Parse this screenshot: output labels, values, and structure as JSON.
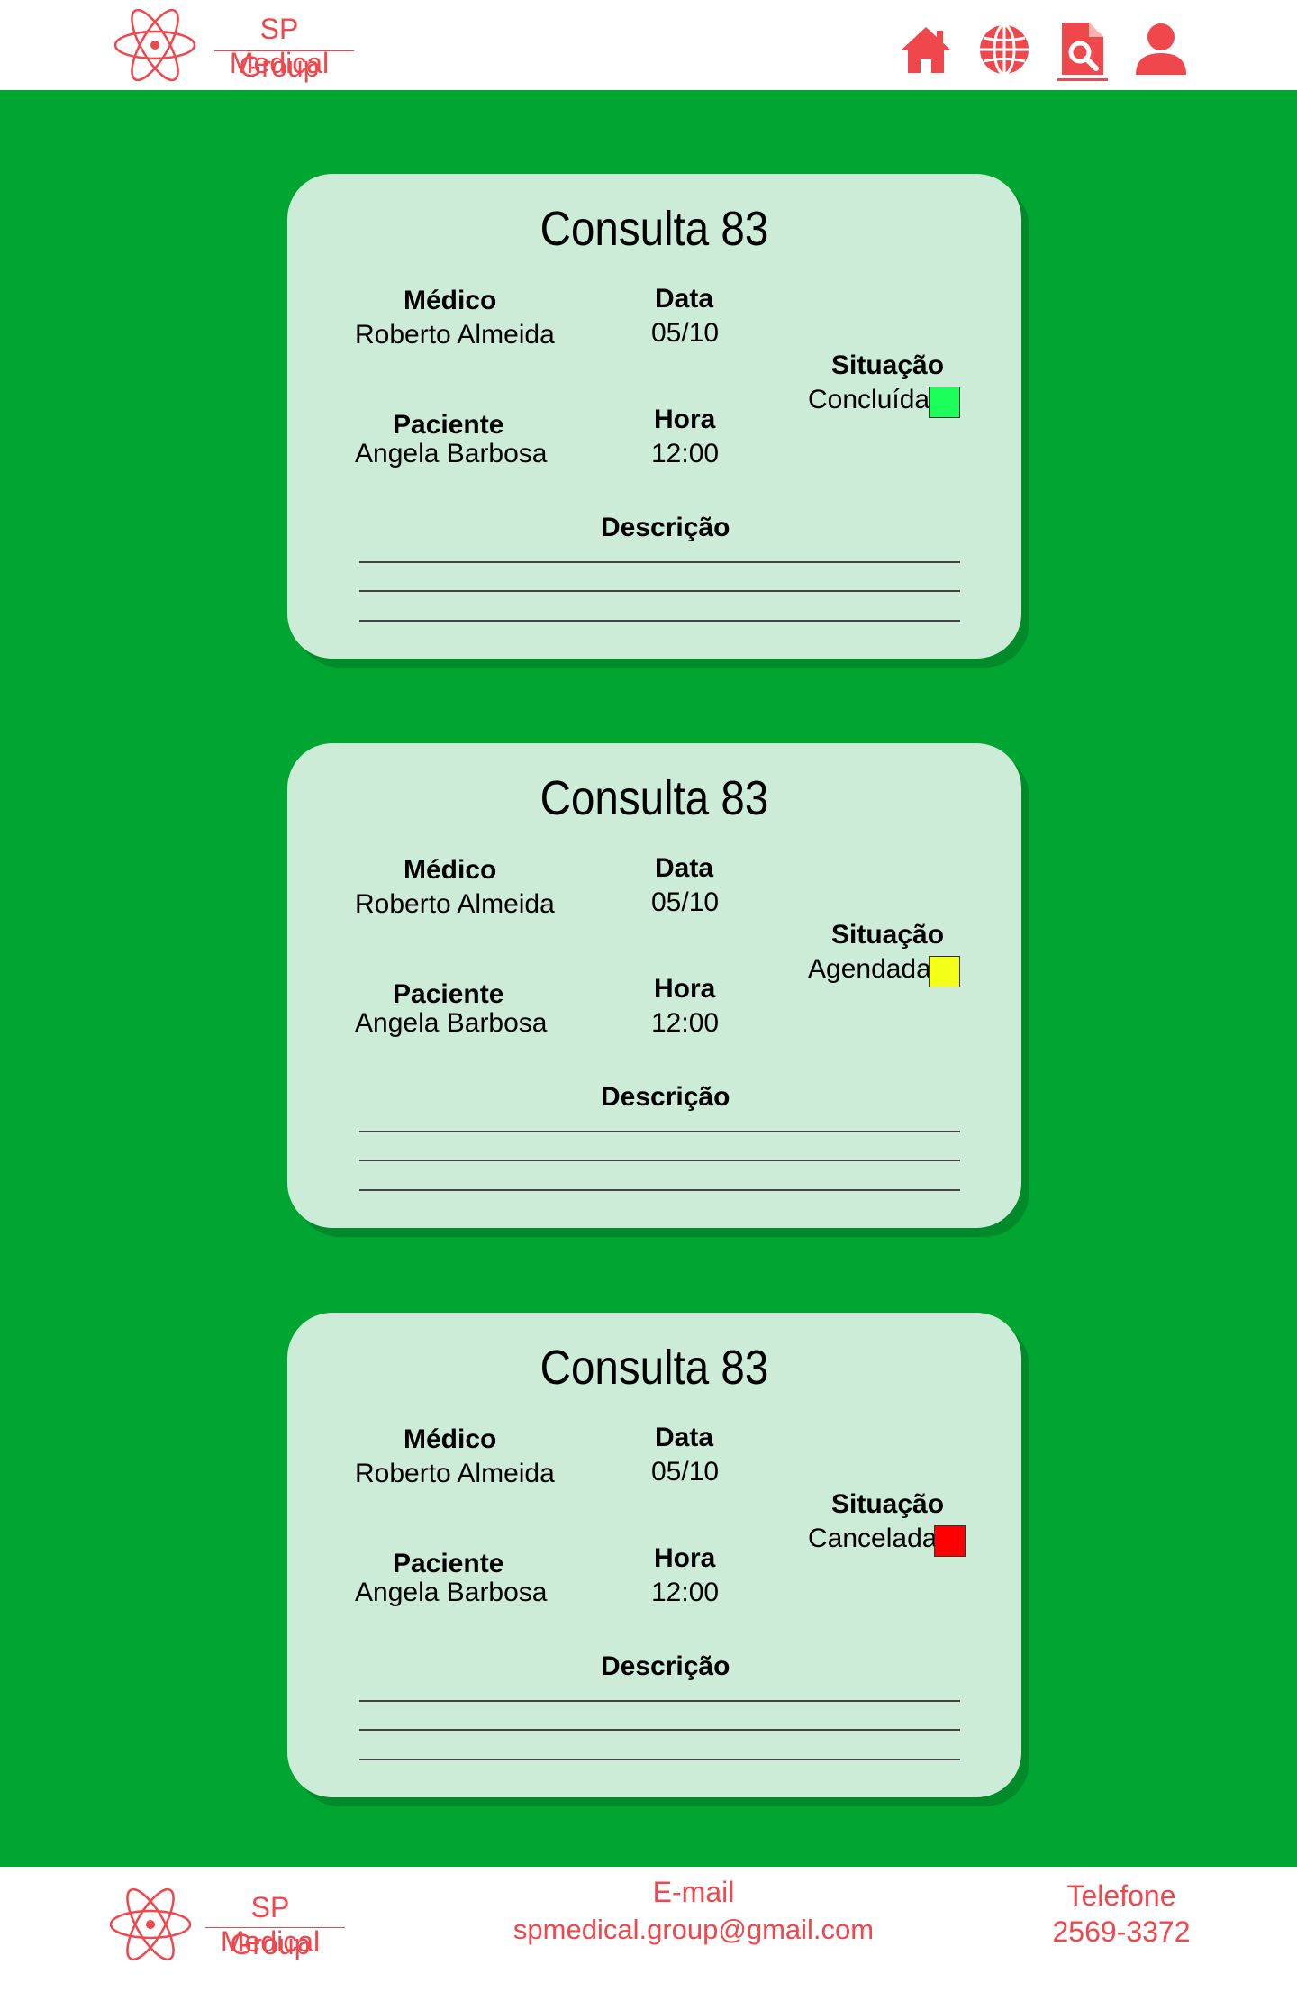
{
  "header": {
    "brand": {
      "name_line1": "SP Medical",
      "name_line2": "Group",
      "logo_icon": "atom-icon"
    },
    "nav": [
      {
        "icon": "home-icon"
      },
      {
        "icon": "globe-icon"
      },
      {
        "icon": "document-search-icon",
        "active": true
      },
      {
        "icon": "user-icon"
      }
    ],
    "accent_color": "#f0474d"
  },
  "background_color": "#00a532",
  "cards": [
    {
      "title": "Consulta 83",
      "medico_label": "Médico",
      "medico_value": "Roberto Almeida",
      "data_label": "Data",
      "data_value": "05/10",
      "paciente_label": "Paciente",
      "paciente_value": "Angela Barbosa",
      "hora_label": "Hora",
      "hora_value": "12:00",
      "situacao_label": "Situação",
      "situacao_value": "Concluída",
      "status_color": "#1aff5a",
      "descricao_label": "Descrição"
    },
    {
      "title": "Consulta 83",
      "medico_label": "Médico",
      "medico_value": "Roberto Almeida",
      "data_label": "Data",
      "data_value": "05/10",
      "paciente_label": "Paciente",
      "paciente_value": "Angela Barbosa",
      "hora_label": "Hora",
      "hora_value": "12:00",
      "situacao_label": "Situação",
      "situacao_value": "Agendada",
      "status_color": "#f3ff16",
      "descricao_label": "Descrição"
    },
    {
      "title": "Consulta 83",
      "medico_label": "Médico",
      "medico_value": "Roberto Almeida",
      "data_label": "Data",
      "data_value": "05/10",
      "paciente_label": "Paciente",
      "paciente_value": "Angela Barbosa",
      "hora_label": "Hora",
      "hora_value": "12:00",
      "situacao_label": "Situação",
      "situacao_value": "Cancelada",
      "status_color": "#ff0000",
      "descricao_label": "Descrição"
    }
  ],
  "footer": {
    "brand": {
      "name_line1": "SP Medical",
      "name_line2": "Group",
      "logo_icon": "atom-icon"
    },
    "email_label": "E-mail",
    "email_value": "spmedical.group@gmail.com",
    "phone_label": "Telefone",
    "phone_value": "2569-3372"
  }
}
